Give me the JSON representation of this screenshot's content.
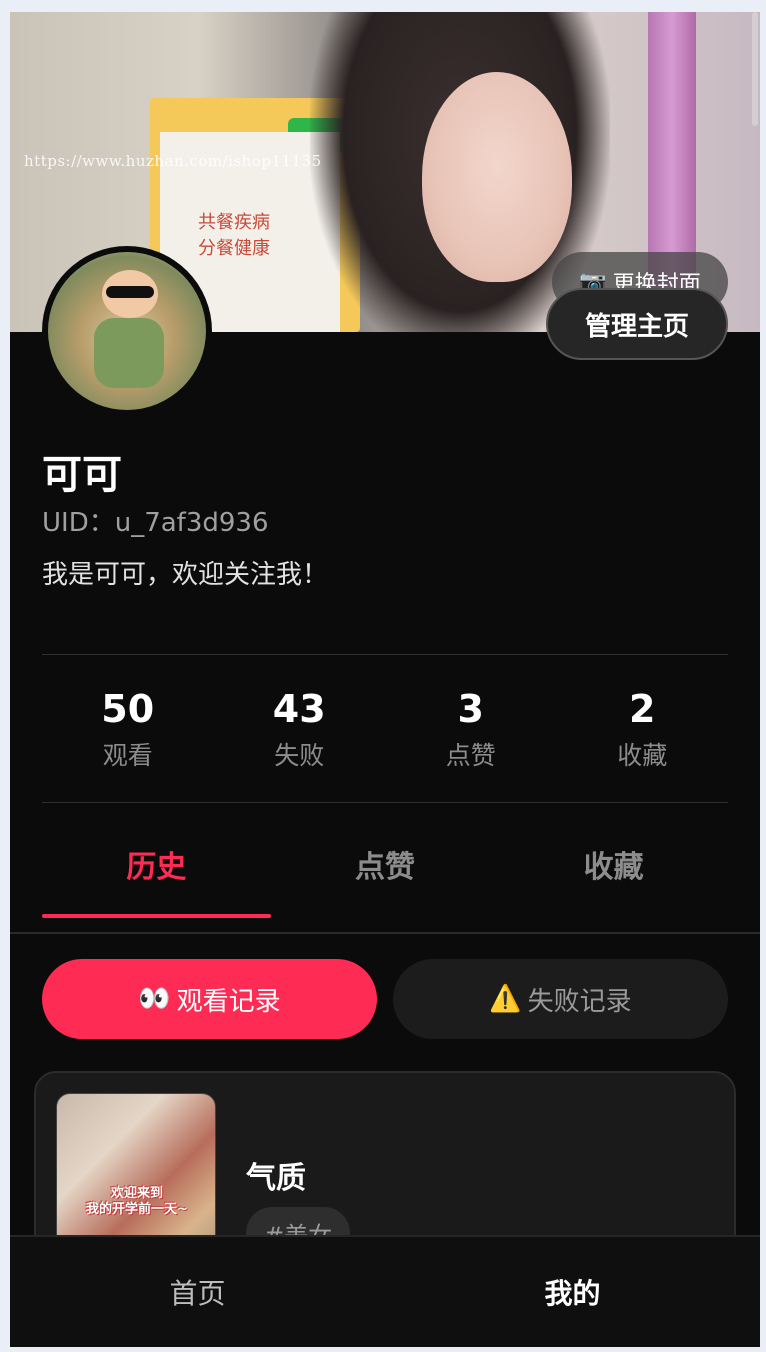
{
  "cover": {
    "watermark": "https://www.huzhan.com/ishop11135",
    "sign_text_1": "共餐疾病",
    "sign_text_2": "分餐健康",
    "change_cover_label": "更换封面",
    "change_cover_icon": "camera-icon"
  },
  "header": {
    "manage_label": "管理主页"
  },
  "profile": {
    "nickname": "可可",
    "uid": "UID：u_7af3d936",
    "bio": "我是可可，欢迎关注我！"
  },
  "stats": [
    {
      "value": "50",
      "label": "观看"
    },
    {
      "value": "43",
      "label": "失败"
    },
    {
      "value": "3",
      "label": "点赞"
    },
    {
      "value": "2",
      "label": "收藏"
    }
  ],
  "tabs": [
    {
      "label": "历史",
      "active": true
    },
    {
      "label": "点赞",
      "active": false
    },
    {
      "label": "收藏",
      "active": false
    }
  ],
  "sub_buttons": {
    "watch": {
      "icon": "👀",
      "label": "观看记录"
    },
    "fail": {
      "icon": "⚠️",
      "label": "失败记录"
    }
  },
  "history": [
    {
      "thumb_text": "欢迎来到\n我的开学前一天~",
      "title": "气质",
      "tag": "#美女"
    }
  ],
  "nav": {
    "home": "首页",
    "mine": "我的"
  },
  "colors": {
    "accent": "#fe2c55",
    "background": "#0b0b0b"
  }
}
